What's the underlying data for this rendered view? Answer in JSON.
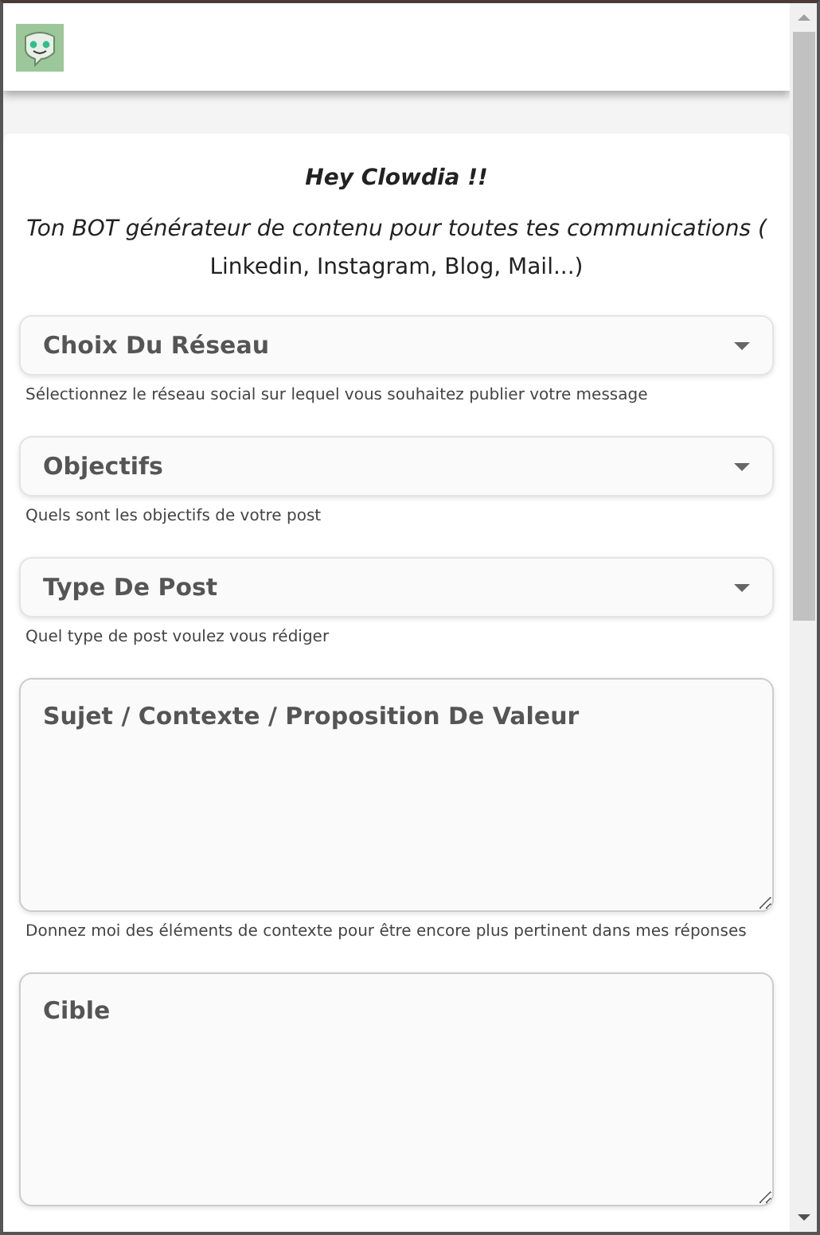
{
  "intro": {
    "title": "Hey Clowdia !!",
    "subtitle": "Ton BOT générateur de contenu pour toutes tes communications (",
    "subtitle_rest": "Linkedin, Instagram, Blog, Mail...)"
  },
  "fields": [
    {
      "kind": "select",
      "placeholder": "Choix Du Réseau",
      "hint": "Sélectionnez le réseau social sur lequel vous souhaitez publier votre message"
    },
    {
      "kind": "select",
      "placeholder": "Objectifs",
      "hint": "Quels sont les objectifs de votre post"
    },
    {
      "kind": "select",
      "placeholder": "Type De Post",
      "hint": "Quel type de post voulez vous rédiger"
    },
    {
      "kind": "textarea",
      "placeholder": "Sujet / Contexte / Proposition De Valeur",
      "hint": "Donnez moi des éléments de contexte pour être encore plus pertinent dans mes réponses"
    },
    {
      "kind": "textarea",
      "placeholder": "Cible"
    }
  ]
}
